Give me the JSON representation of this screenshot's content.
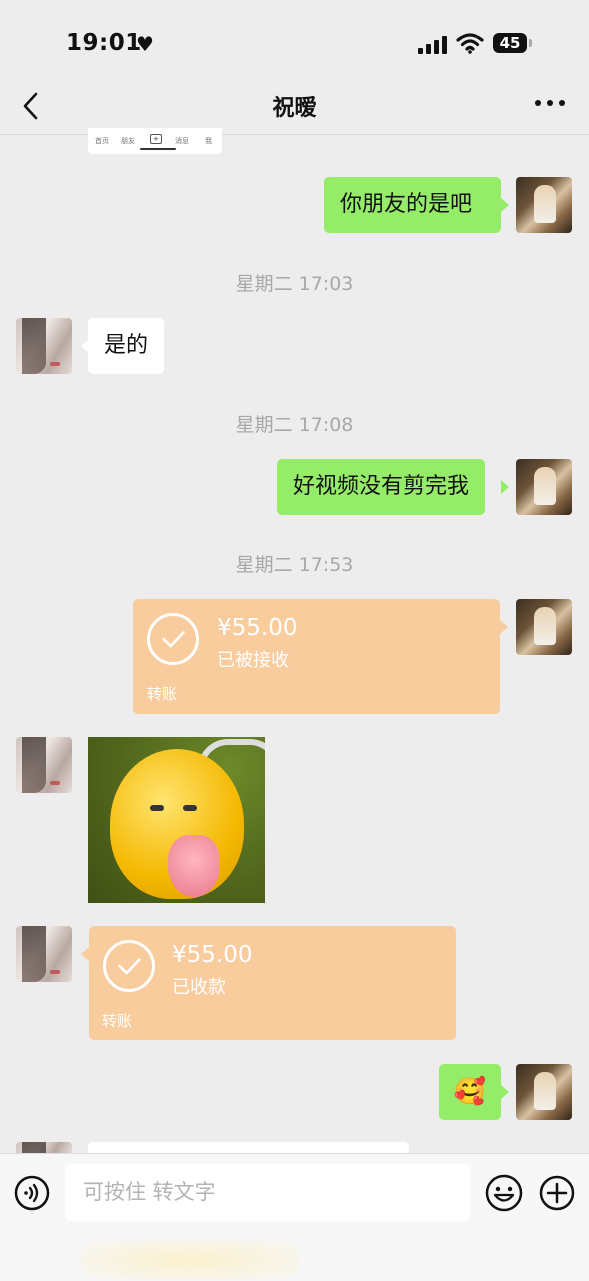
{
  "status_bar": {
    "time": "19:01",
    "heart": "♥",
    "battery": "45"
  },
  "nav": {
    "title": "祝暧",
    "back_icon": "chevron-left-icon",
    "more_icon": "more-dots-icon"
  },
  "partial_image": {
    "tabs": [
      "首页",
      "朋友",
      "+",
      "消息",
      "我"
    ]
  },
  "messages": [
    {
      "side": "right",
      "type": "text",
      "text": "你朋友的是吧"
    },
    {
      "type": "timestamp",
      "text": "星期二 17:03"
    },
    {
      "side": "left",
      "type": "text",
      "text": "是的"
    },
    {
      "type": "timestamp",
      "text": "星期二 17:08"
    },
    {
      "side": "right",
      "type": "text",
      "text": "好视频没有剪完我"
    },
    {
      "type": "timestamp",
      "text": "星期二 17:53"
    },
    {
      "side": "right",
      "type": "transfer",
      "amount": "¥55.00",
      "status": "已被接收",
      "label": "转账"
    },
    {
      "side": "left",
      "type": "image",
      "description_icon": "yellow-creature-sticker"
    },
    {
      "side": "left",
      "type": "transfer",
      "amount": "¥55.00",
      "status": "已收款",
      "label": "转账"
    },
    {
      "side": "right",
      "type": "emoji",
      "text": "🥰"
    }
  ],
  "input_bar": {
    "placeholder": "可按住 转文字",
    "voice_icon": "voice-icon",
    "emoji_icon": "emoji-icon",
    "plus_icon": "plus-icon"
  },
  "colors": {
    "background": "#ededed",
    "bubble_green": "#95ec69",
    "transfer_orange": "#f9cc9d"
  }
}
